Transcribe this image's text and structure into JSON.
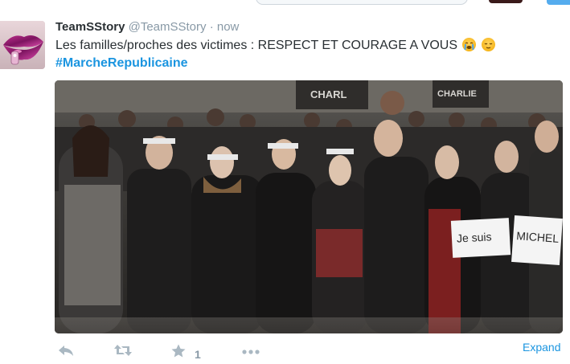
{
  "tweet": {
    "author_name": "TeamSStory",
    "author_handle": "@TeamSStory",
    "separator": "·",
    "time": "now",
    "text": "Les familles/proches des victimes : RESPECT ET COURAGE A VOUS",
    "emojis": [
      "crying-face",
      "relieved-face"
    ],
    "hashtag": "#MarcheRepublicaine"
  },
  "media": {
    "sign_left": "Je suis",
    "sign_right": "MICHEL",
    "background_sign_1": "CHARL",
    "background_sign_2": "CHARLIE"
  },
  "actions": {
    "reply_icon": "reply-icon",
    "retweet_icon": "retweet-icon",
    "favorite_icon": "star-icon",
    "favorite_count": "1",
    "more_icon": "more-dots-icon",
    "expand_label": "Expand"
  },
  "colors": {
    "link": "#1b95e0",
    "text": "#292f33",
    "muted": "#8899a6",
    "action": "#aab8c2"
  }
}
